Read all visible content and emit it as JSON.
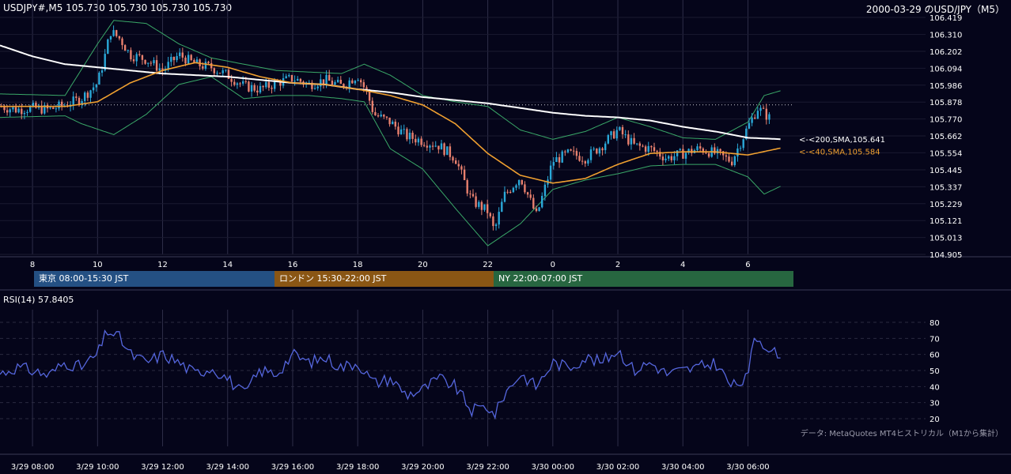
{
  "header": {
    "symbol_info": "USDJPY#,M5 105.730 105.730 105.730 105.730",
    "chart_label": "2000-03-29 のUSD/JPY（M5）"
  },
  "sessions": [
    {
      "label": "東京 08:00-15:30 JST",
      "color": "#245083"
    },
    {
      "label": "ロンドン 15:30-22:00 JST",
      "color": "#8a5614"
    },
    {
      "label": "NY 22:00-07:00 JST",
      "color": "#276640"
    }
  ],
  "rsi_panel": {
    "title": "RSI(14) 57.8405"
  },
  "credit": "データ: MetaQuotes MT4ヒストリカル（M1から集計）",
  "colors": {
    "background": "#05051a",
    "up": "#2aa8d8",
    "down": "#e8806e",
    "sma200": "#ffffff",
    "sma40": "#f0a030",
    "bollinger": "#3aa868",
    "rsi": "#5566dd"
  },
  "chart_data": [
    {
      "type": "candlestick",
      "title": "USD/JPY M5",
      "x_tick_labels": [
        "8",
        "10",
        "12",
        "14",
        "16",
        "18",
        "20",
        "22",
        "0",
        "2",
        "4",
        "6"
      ],
      "x_tick_hours": [
        8,
        10,
        12,
        14,
        16,
        18,
        20,
        22,
        24,
        26,
        28,
        30
      ],
      "x_range_hours": [
        7,
        31.4
      ],
      "y_tick_labels": [
        "106.419",
        "106.310",
        "106.202",
        "106.094",
        "105.986",
        "105.878",
        "105.770",
        "105.662",
        "105.554",
        "105.445",
        "105.337",
        "105.229",
        "105.121",
        "105.013",
        "104.905"
      ],
      "ylim": [
        104.905,
        106.419
      ],
      "reference_line": 105.86,
      "price_keyframes": [
        [
          7.0,
          105.85
        ],
        [
          7.5,
          105.83
        ],
        [
          8.0,
          105.84
        ],
        [
          8.5,
          105.83
        ],
        [
          9.0,
          105.86
        ],
        [
          9.5,
          105.9
        ],
        [
          10.0,
          106.0
        ],
        [
          10.2,
          106.15
        ],
        [
          10.4,
          106.33
        ],
        [
          10.7,
          106.28
        ],
        [
          11.0,
          106.18
        ],
        [
          11.5,
          106.15
        ],
        [
          12.0,
          106.08
        ],
        [
          12.5,
          106.18
        ],
        [
          13.0,
          106.12
        ],
        [
          13.5,
          106.1
        ],
        [
          14.0,
          106.05
        ],
        [
          14.5,
          105.98
        ],
        [
          15.0,
          105.96
        ],
        [
          15.5,
          106.0
        ],
        [
          16.0,
          106.03
        ],
        [
          16.5,
          105.99
        ],
        [
          17.0,
          106.02
        ],
        [
          17.5,
          105.98
        ],
        [
          18.0,
          106.05
        ],
        [
          18.3,
          105.93
        ],
        [
          18.5,
          105.8
        ],
        [
          19.0,
          105.75
        ],
        [
          19.5,
          105.66
        ],
        [
          20.0,
          105.63
        ],
        [
          20.5,
          105.6
        ],
        [
          21.0,
          105.52
        ],
        [
          21.5,
          105.25
        ],
        [
          22.0,
          105.18
        ],
        [
          22.2,
          105.05
        ],
        [
          22.5,
          105.28
        ],
        [
          23.0,
          105.4
        ],
        [
          23.5,
          105.15
        ],
        [
          24.0,
          105.5
        ],
        [
          24.5,
          105.55
        ],
        [
          25.0,
          105.52
        ],
        [
          25.5,
          105.6
        ],
        [
          26.0,
          105.7
        ],
        [
          26.5,
          105.6
        ],
        [
          27.0,
          105.58
        ],
        [
          27.5,
          105.52
        ],
        [
          28.0,
          105.55
        ],
        [
          28.5,
          105.58
        ],
        [
          29.0,
          105.55
        ],
        [
          29.5,
          105.5
        ],
        [
          30.0,
          105.72
        ],
        [
          30.3,
          105.84
        ],
        [
          30.7,
          105.77
        ]
      ],
      "series": [
        {
          "name": "200,SMA",
          "label": "<-<200,SMA,105.641",
          "last_value": 105.641,
          "keyframes": [
            [
              7.0,
              106.24
            ],
            [
              8.0,
              106.17
            ],
            [
              9.0,
              106.12
            ],
            [
              10.0,
              106.1
            ],
            [
              11.0,
              106.08
            ],
            [
              12.0,
              106.06
            ],
            [
              13.0,
              106.05
            ],
            [
              14.0,
              106.04
            ],
            [
              15.0,
              106.02
            ],
            [
              16.0,
              106.0
            ],
            [
              17.0,
              105.99
            ],
            [
              18.0,
              105.96
            ],
            [
              19.0,
              105.94
            ],
            [
              20.0,
              105.91
            ],
            [
              21.0,
              105.89
            ],
            [
              22.0,
              105.87
            ],
            [
              23.0,
              105.84
            ],
            [
              24.0,
              105.81
            ],
            [
              25.0,
              105.79
            ],
            [
              26.0,
              105.78
            ],
            [
              27.0,
              105.76
            ],
            [
              28.0,
              105.72
            ],
            [
              29.0,
              105.69
            ],
            [
              30.0,
              105.65
            ],
            [
              31.0,
              105.641
            ]
          ]
        },
        {
          "name": "40,SMA",
          "label": "<-<40,SMA,105.584",
          "last_value": 105.584,
          "keyframes": [
            [
              7.0,
              105.85
            ],
            [
              9.0,
              105.85
            ],
            [
              10.0,
              105.88
            ],
            [
              11.0,
              106.0
            ],
            [
              12.0,
              106.08
            ],
            [
              13.0,
              106.13
            ],
            [
              14.0,
              106.1
            ],
            [
              15.0,
              106.04
            ],
            [
              16.0,
              106.0
            ],
            [
              17.0,
              105.99
            ],
            [
              18.0,
              105.96
            ],
            [
              19.0,
              105.92
            ],
            [
              20.0,
              105.86
            ],
            [
              21.0,
              105.74
            ],
            [
              22.0,
              105.55
            ],
            [
              23.0,
              105.41
            ],
            [
              24.0,
              105.36
            ],
            [
              25.0,
              105.39
            ],
            [
              26.0,
              105.48
            ],
            [
              27.0,
              105.55
            ],
            [
              28.0,
              105.56
            ],
            [
              29.0,
              105.56
            ],
            [
              30.0,
              105.54
            ],
            [
              31.0,
              105.584
            ]
          ]
        },
        {
          "name": "BB upper",
          "keyframes": [
            [
              7.0,
              105.93
            ],
            [
              9.0,
              105.92
            ],
            [
              10.0,
              106.25
            ],
            [
              10.5,
              106.4
            ],
            [
              11.5,
              106.38
            ],
            [
              12.5,
              106.25
            ],
            [
              13.5,
              106.16
            ],
            [
              14.5,
              106.12
            ],
            [
              15.5,
              106.08
            ],
            [
              16.5,
              106.07
            ],
            [
              17.5,
              106.06
            ],
            [
              18.2,
              106.12
            ],
            [
              19.0,
              106.05
            ],
            [
              20.0,
              105.92
            ],
            [
              21.0,
              105.88
            ],
            [
              22.0,
              105.85
            ],
            [
              23.0,
              105.7
            ],
            [
              24.0,
              105.64
            ],
            [
              25.0,
              105.69
            ],
            [
              26.0,
              105.78
            ],
            [
              27.0,
              105.72
            ],
            [
              28.0,
              105.65
            ],
            [
              29.0,
              105.64
            ],
            [
              30.0,
              105.75
            ],
            [
              30.5,
              105.92
            ],
            [
              31.0,
              105.95
            ]
          ]
        },
        {
          "name": "BB lower",
          "keyframes": [
            [
              7.0,
              105.78
            ],
            [
              9.0,
              105.79
            ],
            [
              9.5,
              105.74
            ],
            [
              10.5,
              105.67
            ],
            [
              11.5,
              105.8
            ],
            [
              12.5,
              105.99
            ],
            [
              13.5,
              106.04
            ],
            [
              14.5,
              105.9
            ],
            [
              15.5,
              105.92
            ],
            [
              16.5,
              105.92
            ],
            [
              17.5,
              105.9
            ],
            [
              18.2,
              105.88
            ],
            [
              19.0,
              105.58
            ],
            [
              20.0,
              105.45
            ],
            [
              21.0,
              105.2
            ],
            [
              22.0,
              104.96
            ],
            [
              23.0,
              105.1
            ],
            [
              24.0,
              105.32
            ],
            [
              25.0,
              105.38
            ],
            [
              26.0,
              105.42
            ],
            [
              27.0,
              105.47
            ],
            [
              28.0,
              105.48
            ],
            [
              29.0,
              105.48
            ],
            [
              30.0,
              105.4
            ],
            [
              30.5,
              105.29
            ],
            [
              31.0,
              105.34
            ]
          ]
        }
      ]
    },
    {
      "type": "line",
      "title": "RSI(14) 57.8405",
      "y_tick_labels": [
        "80",
        "70",
        "60",
        "50",
        "40",
        "30",
        "20"
      ],
      "ylim": [
        20,
        80
      ],
      "x_tick_labels": [
        "3/29 08:00",
        "3/29 10:00",
        "3/29 12:00",
        "3/29 14:00",
        "3/29 16:00",
        "3/29 18:00",
        "3/29 20:00",
        "3/29 22:00",
        "3/30 00:00",
        "3/30 02:00",
        "3/30 04:00",
        "3/30 06:00"
      ],
      "last_value": 57.8405,
      "keyframes": [
        [
          7.0,
          48
        ],
        [
          7.5,
          52
        ],
        [
          8.0,
          50
        ],
        [
          8.5,
          47
        ],
        [
          9.0,
          55
        ],
        [
          9.5,
          52
        ],
        [
          10.0,
          60
        ],
        [
          10.3,
          75
        ],
        [
          10.7,
          70
        ],
        [
          11.0,
          60
        ],
        [
          11.5,
          55
        ],
        [
          12.0,
          60
        ],
        [
          12.5,
          55
        ],
        [
          13.0,
          48
        ],
        [
          13.5,
          52
        ],
        [
          14.0,
          45
        ],
        [
          14.5,
          35
        ],
        [
          15.0,
          50
        ],
        [
          15.5,
          48
        ],
        [
          16.0,
          60
        ],
        [
          16.5,
          55
        ],
        [
          17.0,
          58
        ],
        [
          17.5,
          52
        ],
        [
          18.0,
          55
        ],
        [
          18.5,
          42
        ],
        [
          19.0,
          45
        ],
        [
          19.5,
          35
        ],
        [
          20.0,
          38
        ],
        [
          20.5,
          45
        ],
        [
          21.0,
          40
        ],
        [
          21.5,
          25
        ],
        [
          22.0,
          28
        ],
        [
          22.2,
          21
        ],
        [
          22.5,
          35
        ],
        [
          23.0,
          48
        ],
        [
          23.5,
          40
        ],
        [
          24.0,
          55
        ],
        [
          24.5,
          52
        ],
        [
          25.0,
          58
        ],
        [
          25.5,
          55
        ],
        [
          26.0,
          63
        ],
        [
          26.5,
          50
        ],
        [
          27.0,
          55
        ],
        [
          27.5,
          48
        ],
        [
          28.0,
          50
        ],
        [
          28.5,
          52
        ],
        [
          29.0,
          55
        ],
        [
          29.5,
          40
        ],
        [
          30.0,
          45
        ],
        [
          30.2,
          72
        ],
        [
          30.6,
          65
        ],
        [
          31.0,
          57.8405
        ]
      ]
    }
  ]
}
